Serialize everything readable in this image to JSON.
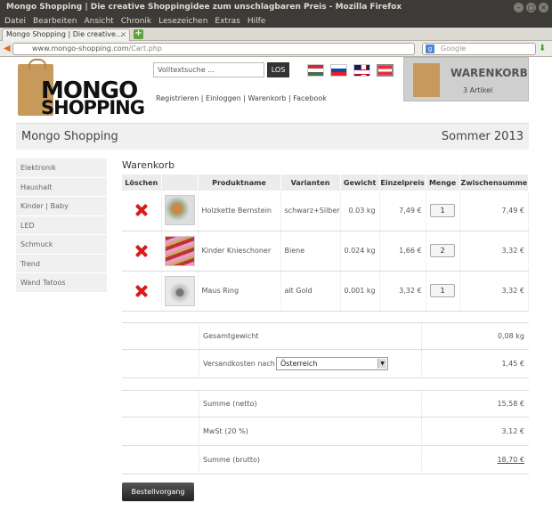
{
  "browser": {
    "title": "Mongo Shopping | Die creative Shoppingidee zum unschlagbaren Preis - Mozilla Firefox",
    "menu": [
      "Datei",
      "Bearbeiten",
      "Ansicht",
      "Chronik",
      "Lesezeichen",
      "Extras",
      "Hilfe"
    ],
    "tab_title": "Mongo Shopping | Die creative...",
    "url_domain": "www.mongo-shopping.com",
    "url_path": "/Cart.php",
    "search_placeholder": "Google"
  },
  "header": {
    "logo_line1": "MONGO",
    "logo_line2": "SHOPPING",
    "search_placeholder": "Volltextsuche ...",
    "search_button": "LOS",
    "links": [
      "Registrieren",
      "Einloggen",
      "Warenkorb",
      "Facebook"
    ],
    "cart_title": "WARENKORB",
    "cart_count": "3 Artikel"
  },
  "band": {
    "left": "Mongo Shopping",
    "right": "Sommer 2013"
  },
  "sidebar": [
    "Elektronik",
    "Haushalt",
    "Kinder | Baby",
    "LED",
    "Schmuck",
    "Trend",
    "Wand Tatoos"
  ],
  "cart": {
    "heading": "Warenkorb",
    "columns": [
      "Löschen",
      "",
      "Produktname",
      "Varianten",
      "Gewicht",
      "Einzelpreis",
      "Menge",
      "Zwischensumme"
    ],
    "rows": [
      {
        "name": "Holzkette Bernstein",
        "variant": "schwarz+Silber",
        "weight": "0.03 kg",
        "price": "7,49 €",
        "qty": "1",
        "subtotal": "7,49 €"
      },
      {
        "name": "Kinder Knieschoner",
        "variant": "Biene",
        "weight": "0.024 kg",
        "price": "1,66 €",
        "qty": "2",
        "subtotal": "3,32 €"
      },
      {
        "name": "Maus Ring",
        "variant": "alt Gold",
        "weight": "0.001 kg",
        "price": "3,32 €",
        "qty": "1",
        "subtotal": "3,32 €"
      }
    ]
  },
  "summary": {
    "weight_label": "Gesamtgewicht",
    "weight_value": "0,08 kg",
    "shipping_label": "Versandkosten nach",
    "shipping_country": "Österreich",
    "shipping_value": "1,45 €",
    "net_label": "Summe (netto)",
    "net_value": "15,58 €",
    "vat_label": "MwSt (20 %)",
    "vat_value": "3,12 €",
    "gross_label": "Summe (brutto)",
    "gross_value": "18,70 €"
  },
  "checkout_button": "Bestellvorgang"
}
